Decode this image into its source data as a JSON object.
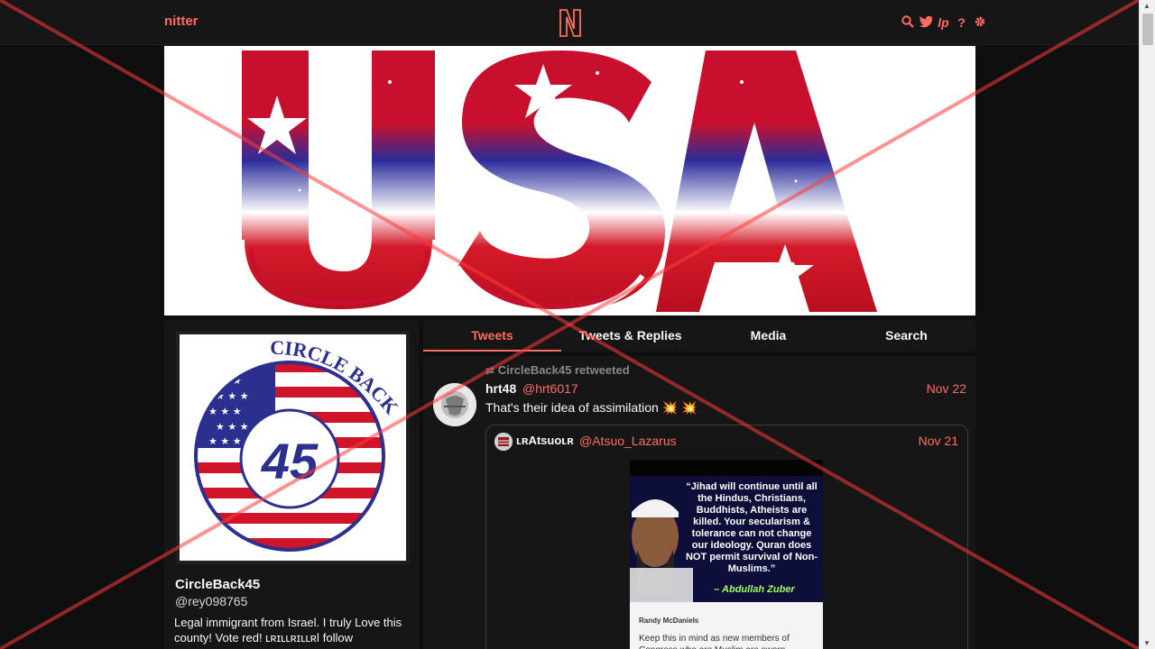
{
  "nav": {
    "brand": "nitter",
    "logo_letter": "N",
    "icons": [
      "search-icon",
      "twitter-icon",
      "rss-icon",
      "help-icon",
      "settings-icon"
    ],
    "accent": "#ff6c60"
  },
  "banner": {
    "text": "USA"
  },
  "profile": {
    "avatar_text_top": "CIRCLE BACK",
    "avatar_number": "45",
    "fullname": "CircleBack45",
    "username": "@rey098765",
    "bio": "Legal immigrant from Israel. I truly Love this county! Vote red! ʟʀɪʟʟʀɪʟʟʀǀ follow"
  },
  "tabs": [
    {
      "label": "Tweets",
      "active": true
    },
    {
      "label": "Tweets & Replies",
      "active": false
    },
    {
      "label": "Media",
      "active": false
    },
    {
      "label": "Search",
      "active": false
    }
  ],
  "tweet": {
    "retweet_header": "CircleBack45 retweeted",
    "fullname": "hrt48",
    "username": "@hrt6017",
    "date": "Nov 22",
    "content": "That's their idea of assimilation 💥 💥",
    "quote": {
      "fullname": "ʟʀAtsuoʟʀ",
      "username": "@Atsuo_Lazarus",
      "date": "Nov 21",
      "media": {
        "quote_text": "“Jihad will continue until all the Hindus, Christians, Buddhists, Atheists are killed. Your secularism & tolerance can not change our ideology. Quran does NOT permit survival of Non-Muslims.”",
        "attribution": "– Abdullah Zuber",
        "post_author": "Randy McDaniels",
        "post_body": "Keep this in mind as new members of Congress who are Muslim are sworn"
      }
    }
  }
}
